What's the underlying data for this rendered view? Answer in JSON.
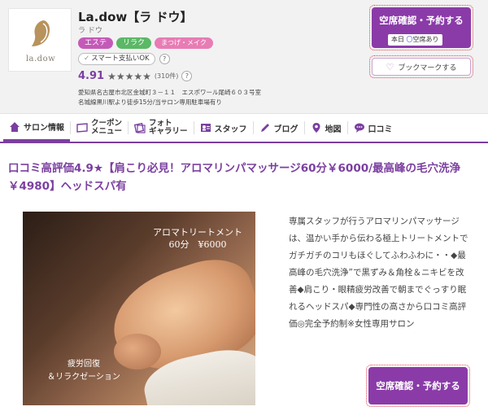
{
  "salon": {
    "name": "La.dow【ラ ドウ】",
    "kana": "ラ ドウ",
    "logo_text": "la.dow",
    "categories": [
      "エステ",
      "リラク",
      "まつげ・メイク"
    ],
    "smart_pay": "スマート支払いOK",
    "help_mark": "?",
    "rating": "4.91",
    "stars": "★★★★★",
    "review_count": "(310件)",
    "address_line1": "愛知県名古屋市北区金城町３－１１　エスポワール尾崎６０３号室",
    "address_line2": "名城線黒川駅より徒歩15分/当サロン専用駐車場有り"
  },
  "actions": {
    "reserve_label": "空席確認・予約する",
    "availability_prefix": "本日",
    "availability_mark": "〇",
    "availability_text": "空席あり",
    "bookmark_label": "ブックマークする"
  },
  "nav": {
    "tabs": [
      {
        "label": "サロン情報",
        "icon": "house-icon"
      },
      {
        "label": "クーポン\nメニュー",
        "icon": "coupon-icon"
      },
      {
        "label": "フォト\nギャラリー",
        "icon": "photo-icon"
      },
      {
        "label": "スタッフ",
        "icon": "staff-icon"
      },
      {
        "label": "ブログ",
        "icon": "pencil-icon"
      },
      {
        "label": "地図",
        "icon": "map-pin-icon"
      },
      {
        "label": "口コミ",
        "icon": "chat-icon"
      }
    ]
  },
  "main": {
    "headline": "口コミ高評価4.9★【肩こり必見！アロマリンパマッサージ60分￥6000/最高峰の毛穴洗浄￥4980】ヘッドスパ有",
    "photo_title_line1": "アロマトリートメント",
    "photo_title_line2": "60分　¥6000",
    "photo_caption_line1": "疲労回復",
    "photo_caption_line2": "＆リラクゼーション",
    "description": "専属スタッフが行うアロマリンパマッサージは、温かい手から伝わる極上トリートメントでガチガチのコリもほぐしてふわふわに・・◆最高峰の毛穴洗浄”で黒ずみ＆角栓＆ニキビを改善◆肩こり・眼精疲労改善で朝までぐっすり眠れるヘッドスパ◆専門性の高さから口コミ高評価◎完全予約制※女性専用サロン"
  },
  "colors": {
    "brand_purple": "#7b3fa0",
    "button_purple": "#8a3ba8",
    "dotted_red": "#e34552"
  }
}
